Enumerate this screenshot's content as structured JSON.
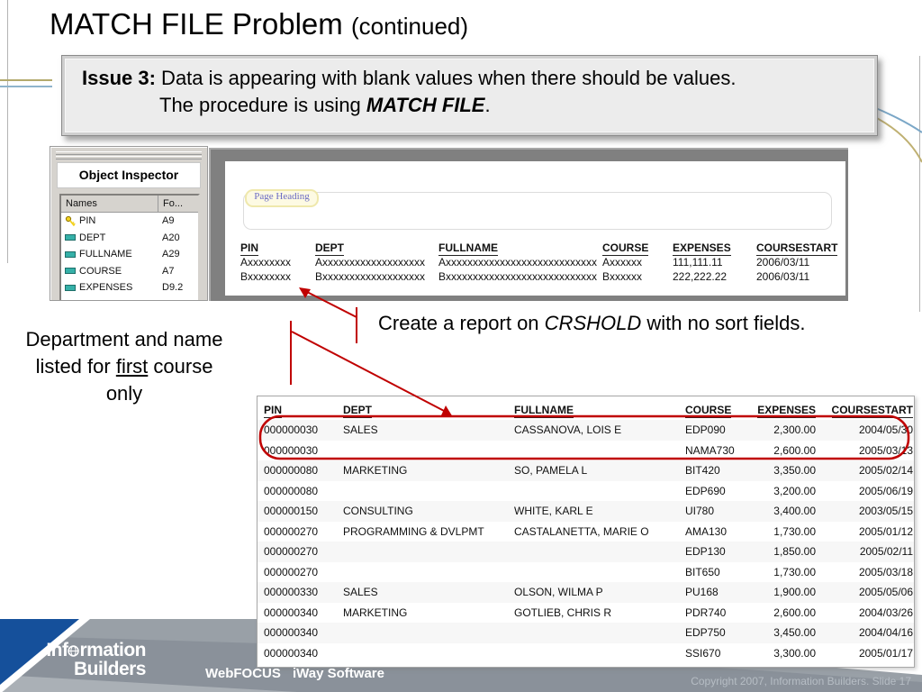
{
  "slide": {
    "title": "MATCH FILE Problem ",
    "title_suffix": "(continued)",
    "issue": {
      "label": "Issue 3:",
      "line1_rest": " Data is appearing with blank values when there should be values.",
      "line2_prefix": "The procedure is using ",
      "line2_emphasis": "MATCH FILE",
      "line2_suffix": "."
    },
    "annotations": {
      "create_prefix": "Create a report on ",
      "create_italic": "CRSHOLD",
      "create_suffix": " with no sort fields.",
      "dept_line1": "Department and name",
      "dept_line2_prefix": "listed for ",
      "dept_line2_underlined": "first",
      "dept_line2_suffix": " course only"
    },
    "copyright": "Copyright 2007, Information Builders. Slide 17",
    "accent_red": "#c00000",
    "footer_blue": "#15509b",
    "curve_blue": "#7ba7c7",
    "curve_tan": "#bfb briefcase072"
  },
  "inspector": {
    "title": "Object Inspector",
    "columns": [
      "Names",
      "Fo..."
    ],
    "fields": [
      {
        "name": "PIN",
        "format": "A9",
        "icon": "key-icon"
      },
      {
        "name": "DEPT",
        "format": "A20",
        "icon": "field-icon"
      },
      {
        "name": "FULLNAME",
        "format": "A29",
        "icon": "field-icon"
      },
      {
        "name": "COURSE",
        "format": "A7",
        "icon": "field-icon"
      },
      {
        "name": "EXPENSES",
        "format": "D9.2",
        "icon": "field-icon"
      }
    ]
  },
  "preview": {
    "page_heading_label": "Page Heading",
    "columns": [
      "PIN",
      "DEPT",
      "FULLNAME",
      "COURSE",
      "EXPENSES",
      "COURSESTART"
    ],
    "rows": [
      [
        "Axxxxxxxx",
        "Axxxxxxxxxxxxxxxxxxx",
        "Axxxxxxxxxxxxxxxxxxxxxxxxxxxx",
        "Axxxxxx",
        "111,111.11",
        "2006/03/11"
      ],
      [
        "Bxxxxxxxx",
        "Bxxxxxxxxxxxxxxxxxxx",
        "Bxxxxxxxxxxxxxxxxxxxxxxxxxxxx",
        "Bxxxxxx",
        "222,222.22",
        "2006/03/11"
      ]
    ]
  },
  "report": {
    "columns": [
      "PIN",
      "DEPT",
      "FULLNAME",
      "COURSE",
      "EXPENSES",
      "COURSESTART"
    ],
    "rows": [
      [
        "000000030",
        "SALES",
        "CASSANOVA, LOIS E",
        "EDP090",
        "2,300.00",
        "2004/05/30"
      ],
      [
        "000000030",
        "",
        "",
        "NAMA730",
        "2,600.00",
        "2005/03/13"
      ],
      [
        "000000080",
        "MARKETING",
        "SO, PAMELA L",
        "BIT420",
        "3,350.00",
        "2005/02/14"
      ],
      [
        "000000080",
        "",
        "",
        "EDP690",
        "3,200.00",
        "2005/06/19"
      ],
      [
        "000000150",
        "CONSULTING",
        "WHITE, KARL E",
        "UI780",
        "3,400.00",
        "2003/05/15"
      ],
      [
        "000000270",
        "PROGRAMMING & DVLPMT",
        "CASTALANETTA, MARIE O",
        "AMA130",
        "1,730.00",
        "2005/01/12"
      ],
      [
        "000000270",
        "",
        "",
        "EDP130",
        "1,850.00",
        "2005/02/11"
      ],
      [
        "000000270",
        "",
        "",
        "BIT650",
        "1,730.00",
        "2005/03/18"
      ],
      [
        "000000330",
        "SALES",
        "OLSON, WILMA P",
        "PU168",
        "1,900.00",
        "2005/05/06"
      ],
      [
        "000000340",
        "MARKETING",
        "GOTLIEB, CHRIS R",
        "PDR740",
        "2,600.00",
        "2004/03/26"
      ],
      [
        "000000340",
        "",
        "",
        "EDP750",
        "3,450.00",
        "2004/04/16"
      ],
      [
        "000000340",
        "",
        "",
        "SSI670",
        "3,300.00",
        "2005/01/17"
      ]
    ]
  },
  "footer": {
    "logo_line1_prefix": "Inf",
    "logo_line1_suffix": "rmation",
    "logo_line2": "Builders",
    "webfocus": "WebFOCUS",
    "iway": "iWay Software"
  }
}
